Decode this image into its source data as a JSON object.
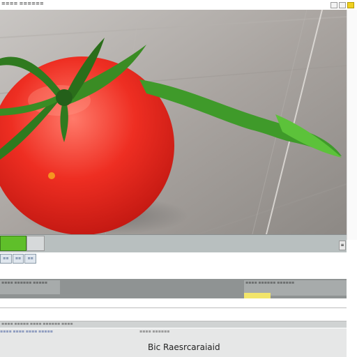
{
  "window": {
    "title_text": "≡≡≡≡ ≡≡≡≡≡≡",
    "buttons": [
      "",
      "",
      ""
    ]
  },
  "image": {
    "description_icon": "tomato-image"
  },
  "strip1": {
    "label": "",
    "scroll_glyph": "≡"
  },
  "mini_toolbar": {
    "buttons": [
      "≡≡",
      "≡≡",
      "≡≡"
    ]
  },
  "bar_dark": {
    "left_text": "≡≡≡≡ ≡≡≡≡≡≡ ≡≡≡≡≡",
    "right_text": "≡≡≡≡ ≡≡≡≡≡≡ ≡≡≡≡≡≡"
  },
  "row3": {
    "text": "≡≡≡≡ ≡≡≡≡≡ ≡≡≡≡ ≡≡≡≡≡≡ ≡≡≡≡"
  },
  "status": {
    "left_text": "≡≡≡≡ ≡≡≡≡ ≡≡≡≡ ≡≡≡≡≡",
    "mid_text": "≡≡≡≡ ≡≡≡≡≡≡",
    "caption": "Bic Raesrcaraiaid"
  },
  "colors": {
    "accent_green": "#5fbf2a",
    "tomato_red": "#e8322a",
    "chip_yellow": "#f2e56a"
  }
}
